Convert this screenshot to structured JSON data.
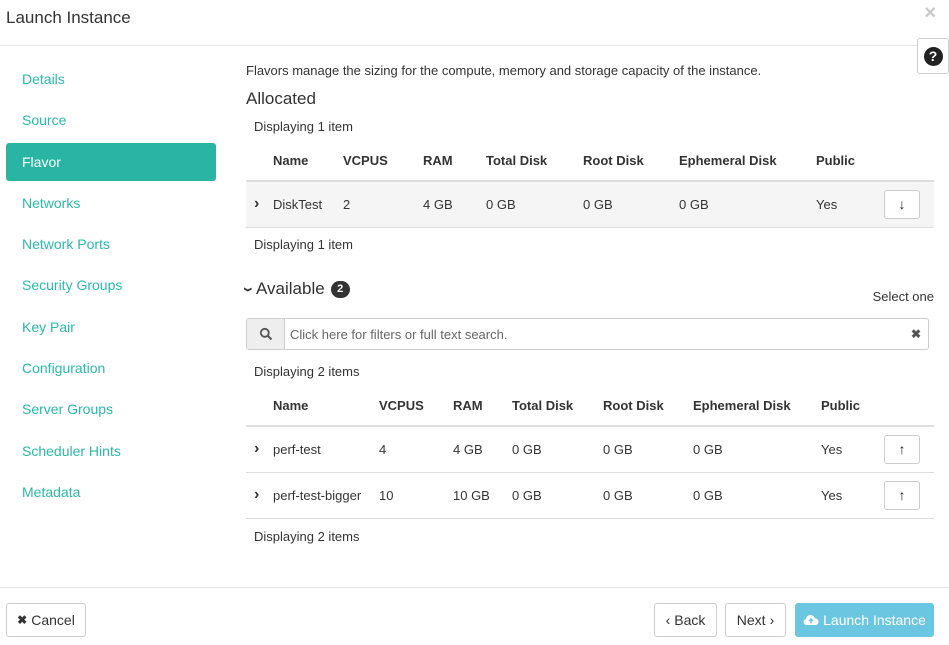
{
  "header": {
    "title": "Launch Instance",
    "close_icon": "×"
  },
  "help": {
    "icon": "?"
  },
  "sidebar": {
    "items": [
      {
        "label": "Details"
      },
      {
        "label": "Source"
      },
      {
        "label": "Flavor"
      },
      {
        "label": "Networks"
      },
      {
        "label": "Network Ports"
      },
      {
        "label": "Security Groups"
      },
      {
        "label": "Key Pair"
      },
      {
        "label": "Configuration"
      },
      {
        "label": "Server Groups"
      },
      {
        "label": "Scheduler Hints"
      },
      {
        "label": "Metadata"
      }
    ],
    "active": "Flavor",
    "accent_color": "#2ab4a3"
  },
  "main": {
    "description": "Flavors manage the sizing for the compute, memory and storage capacity of the instance.",
    "allocated": {
      "title": "Allocated",
      "display_top": "Displaying 1 item",
      "display_bottom": "Displaying 1 item",
      "columns": [
        "Name",
        "VCPUS",
        "RAM",
        "Total Disk",
        "Root Disk",
        "Ephemeral Disk",
        "Public"
      ],
      "rows": [
        {
          "name": "DiskTest",
          "vcpus": "2",
          "ram": "4 GB",
          "total_disk": "0 GB",
          "root_disk": "0 GB",
          "ephemeral_disk": "0 GB",
          "public": "Yes"
        }
      ]
    },
    "available": {
      "title": "Available",
      "count": "2",
      "select_hint": "Select one",
      "search_placeholder": "Click here for filters or full text search.",
      "display_top": "Displaying 2 items",
      "display_bottom": "Displaying 2 items",
      "columns": [
        "Name",
        "VCPUS",
        "RAM",
        "Total Disk",
        "Root Disk",
        "Ephemeral Disk",
        "Public"
      ],
      "rows": [
        {
          "name": "perf-test",
          "vcpus": "4",
          "ram": "4 GB",
          "total_disk": "0 GB",
          "root_disk": "0 GB",
          "ephemeral_disk": "0 GB",
          "public": "Yes"
        },
        {
          "name": "perf-test-bigger",
          "vcpus": "10",
          "ram": "10 GB",
          "total_disk": "0 GB",
          "root_disk": "0 GB",
          "ephemeral_disk": "0 GB",
          "public": "Yes"
        }
      ]
    }
  },
  "footer": {
    "cancel_label": "Cancel",
    "back_label": "Back",
    "next_label": "Next",
    "launch_label": "Launch Instance",
    "launch_color": "#5bc0de"
  }
}
